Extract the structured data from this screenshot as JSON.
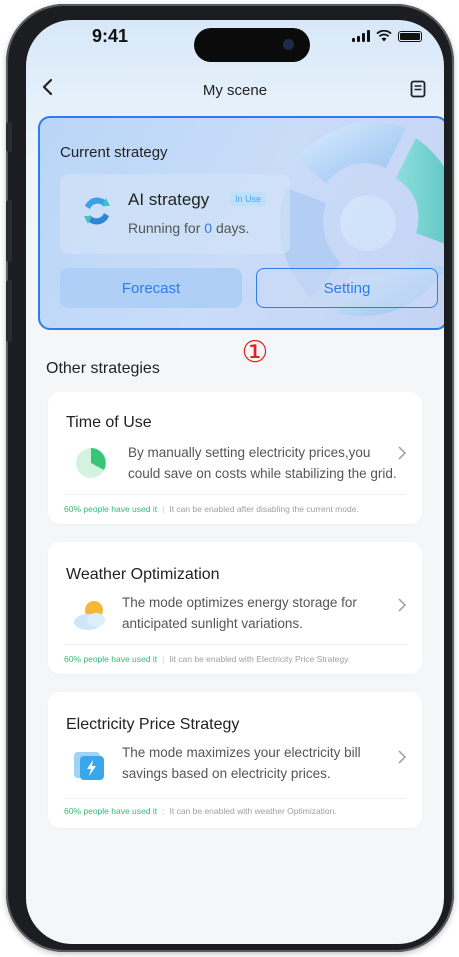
{
  "status": {
    "time": "9:41"
  },
  "nav": {
    "title": "My scene"
  },
  "current": {
    "label": "Current strategy",
    "name": "AI strategy",
    "badge": "In Use",
    "running_prefix": "Running for ",
    "days": "0",
    "running_suffix": " days.",
    "forecast": "Forecast",
    "setting": "Setting"
  },
  "annotation": "①",
  "other": {
    "title": "Other strategies",
    "cards": [
      {
        "title": "Time of Use",
        "desc_line1": "By manually setting electricity prices,you",
        "desc_line2": "could save on costs while stabilizing the grid.",
        "used": "60% people have used it",
        "note": "It can be enabled after disabling the current mode."
      },
      {
        "title": "Weather Optimization",
        "desc_line1": "The mode optimizes energy storage for",
        "desc_line2": "anticipated sunlight variations.",
        "used": "60% people have used it",
        "note": "Iit can be enabled with Electricity Price Strategy."
      },
      {
        "title": "Electricity Price Strategy",
        "desc_line1": "The mode maximizes your electricity bill",
        "desc_line2": "savings based on electricity prices.",
        "used": "60% people have used it",
        "note": "It can be enabled with weather Optimization."
      }
    ]
  },
  "icons": {
    "back": "chevron-left-icon",
    "document": "document-icon",
    "ai": "ai-strategy-icon",
    "time_of_use": "pie-chart-icon",
    "weather": "sun-cloud-icon",
    "price": "electricity-bill-icon",
    "chevron": "chevron-right-icon"
  },
  "colors": {
    "accent": "#2b7de9",
    "used_green": "#2fbb76",
    "annotation_red": "#e02020"
  }
}
